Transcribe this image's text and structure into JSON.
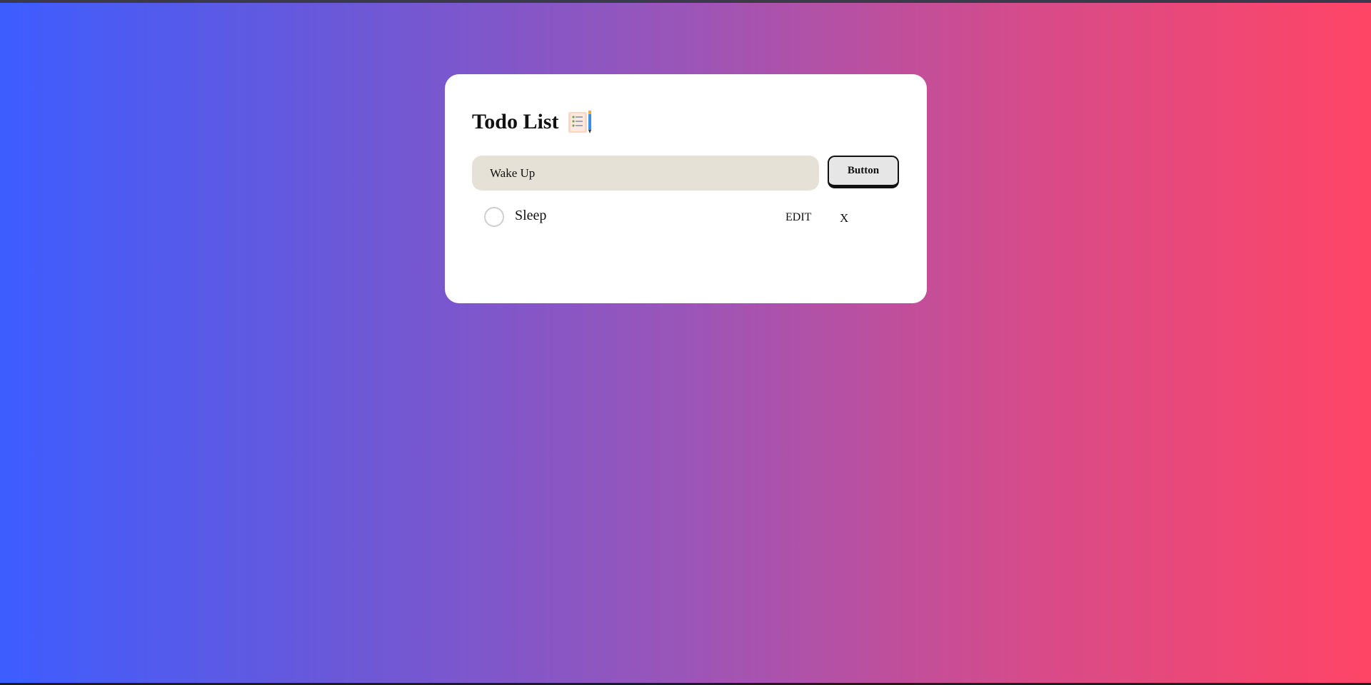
{
  "app": {
    "title": "Todo List",
    "title_icon": "clipboard-checklist-icon"
  },
  "form": {
    "input_value": "Wake Up",
    "submit_label": "Button"
  },
  "todos": [
    {
      "text": "Sleep",
      "completed": false,
      "edit_label": "EDIT",
      "delete_label": "X"
    }
  ],
  "colors": {
    "gradient_start": "#3d5dff",
    "gradient_end": "#ff4566",
    "card_bg": "#ffffff",
    "input_bg": "#e5e1d6",
    "button_bg": "#e6e6e6"
  }
}
